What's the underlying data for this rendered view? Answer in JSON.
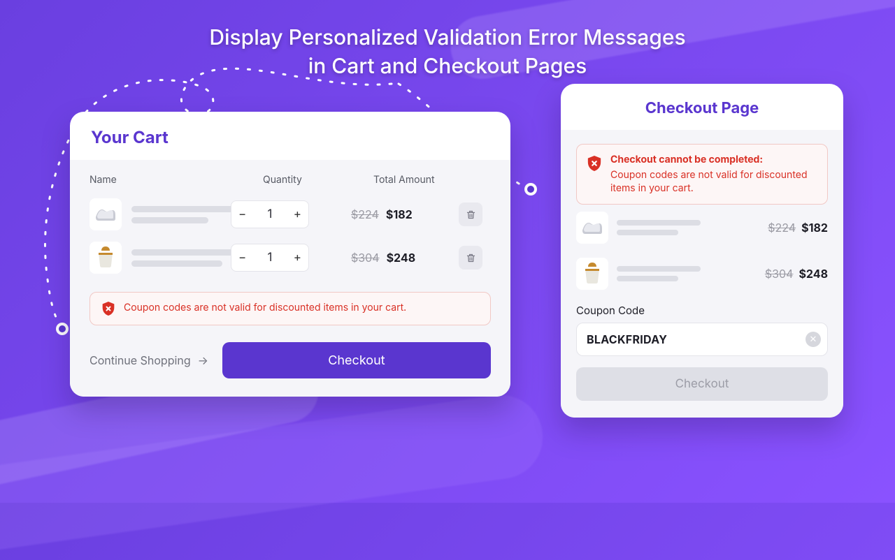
{
  "headline": {
    "line1": "Display Personalized Validation Error Messages",
    "line2": "in Cart and Checkout Pages"
  },
  "cart": {
    "title": "Your Cart",
    "columns": {
      "name": "Name",
      "qty": "Quantity",
      "total": "Total Amount"
    },
    "items": [
      {
        "qty": "1",
        "original": "$224",
        "price": "$182"
      },
      {
        "qty": "1",
        "original": "$304",
        "price": "$248"
      }
    ],
    "error": "Coupon codes are not valid for discounted items in your cart.",
    "continue": "Continue Shopping",
    "checkout": "Checkout"
  },
  "checkout": {
    "title": "Checkout Page",
    "error_title": "Checkout cannot be completed:",
    "error_body": "Coupon codes are not valid for discounted items in your cart.",
    "items": [
      {
        "original": "$224",
        "price": "$182"
      },
      {
        "original": "$304",
        "price": "$248"
      }
    ],
    "coupon_label": "Coupon Code",
    "coupon_value": "BLACKFRIDAY",
    "button": "Checkout"
  }
}
